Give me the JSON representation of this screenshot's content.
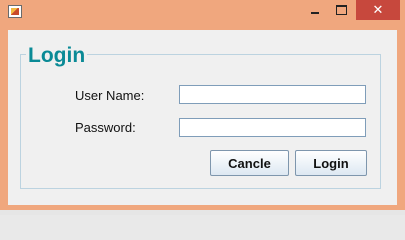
{
  "window": {
    "title": "",
    "close_glyph": "✕",
    "title_color": "#f0a77e"
  },
  "form": {
    "heading": "Login",
    "heading_color": "#0a8a96",
    "username_label": "User Name:",
    "username_value": "",
    "password_label": "Password:",
    "password_value": "",
    "cancel_label": "Cancle",
    "login_label": "Login"
  },
  "icons": {
    "app": "java-app-icon",
    "minimize": "minimize-icon",
    "maximize": "maximize-icon",
    "close": "close-icon"
  }
}
